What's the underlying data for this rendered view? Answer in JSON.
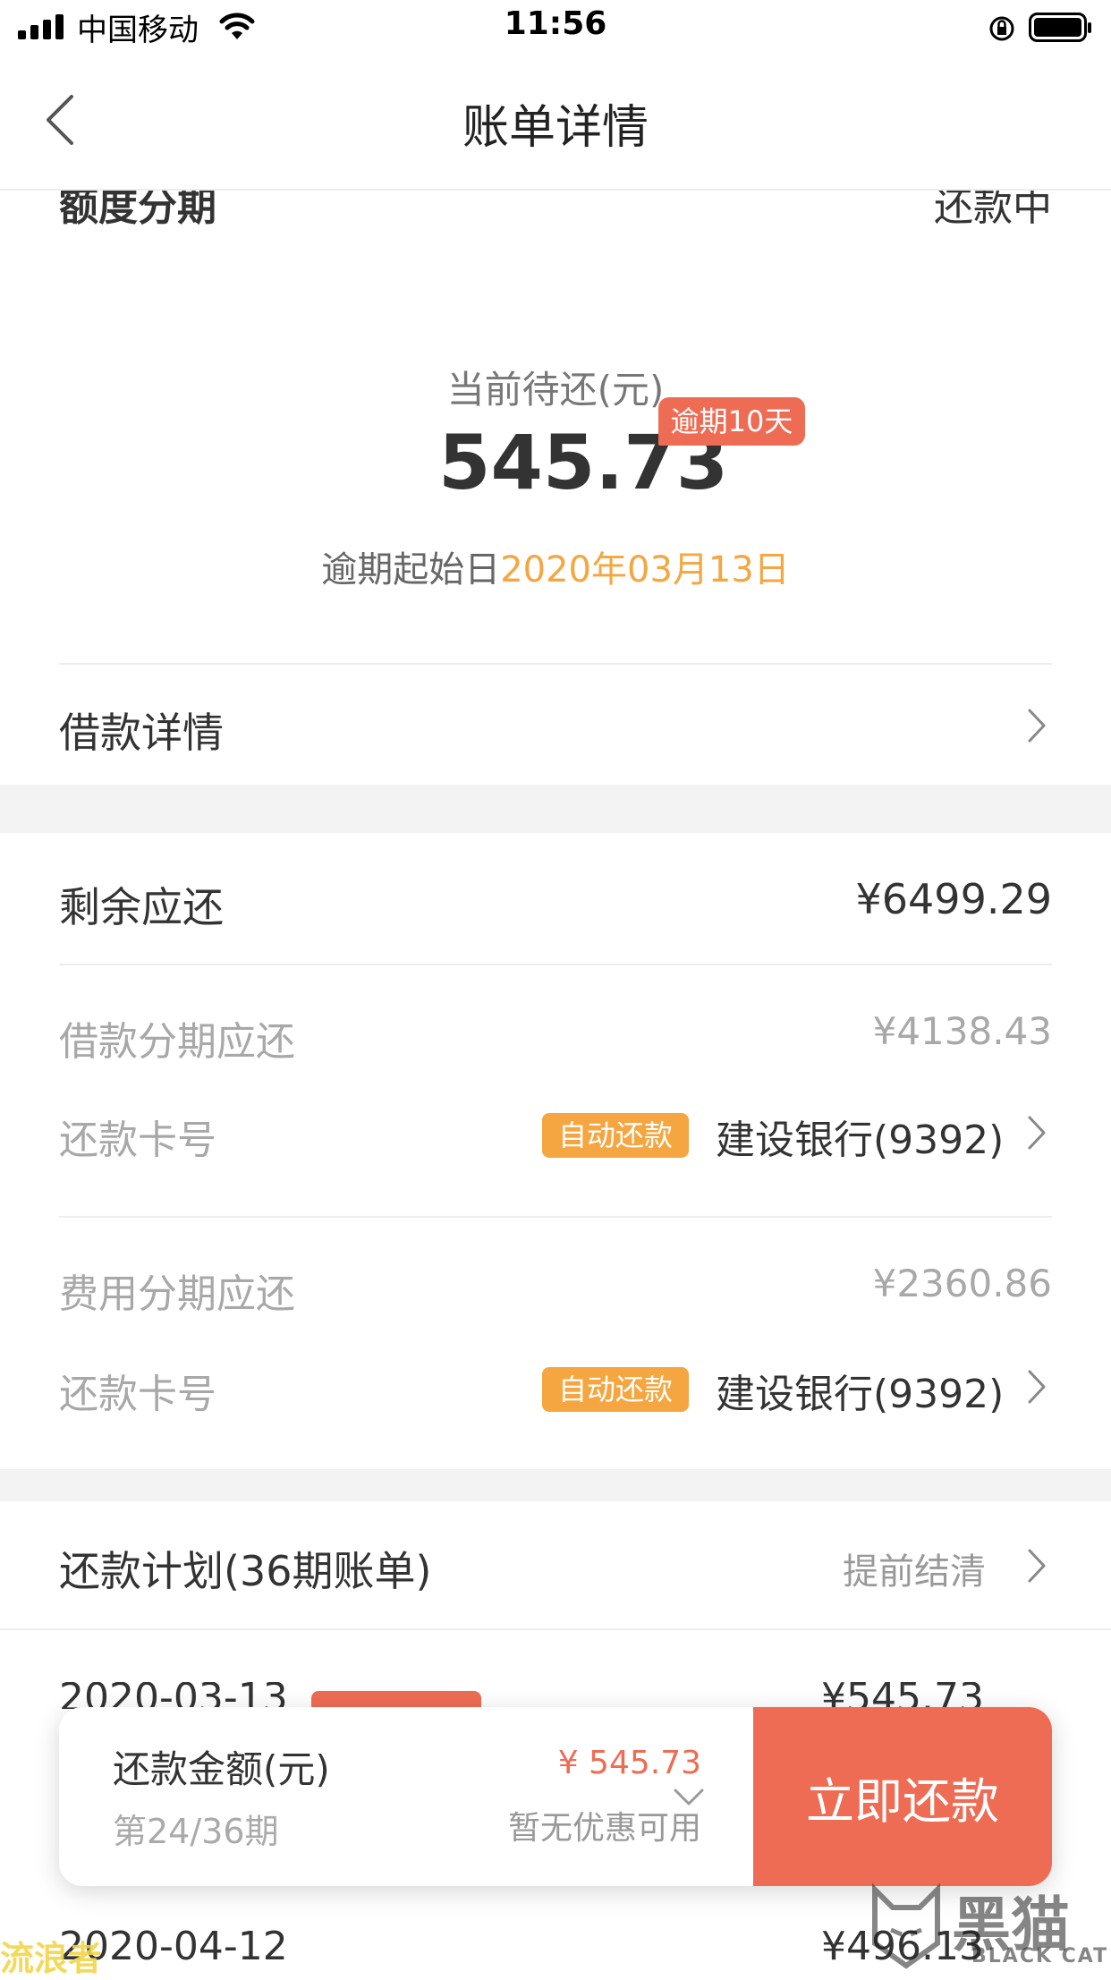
{
  "status_bar": {
    "carrier": "中国移动",
    "time": "11:56"
  },
  "header": {
    "title": "账单详情"
  },
  "summary": {
    "product": "额度分期",
    "status": "还款中",
    "pending_label": "当前待还(元)",
    "pending_amount": "545.73",
    "overdue_badge": "逾期10天",
    "overdue_start_label": "逾期起始日",
    "overdue_start_date": "2020年03月13日"
  },
  "loan_details": {
    "label": "借款详情"
  },
  "remaining": {
    "label": "剩余应还",
    "amount": "¥6499.29",
    "groups": [
      {
        "label": "借款分期应还",
        "amount": "¥4138.43",
        "card_label": "还款卡号",
        "tag": "自动还款",
        "bank": "建设银行(9392)"
      },
      {
        "label": "费用分期应还",
        "amount": "¥2360.86",
        "card_label": "还款卡号",
        "tag": "自动还款",
        "bank": "建设银行(9392)"
      }
    ]
  },
  "plan": {
    "title": "还款计划(36期账单)",
    "action": "提前结清",
    "rows": [
      {
        "date": "2020-03-13",
        "amount": "¥545.73"
      },
      {
        "date": "2020-04-12",
        "amount": "¥496.13"
      }
    ]
  },
  "bottom_bar": {
    "amount_label": "还款金额(元)",
    "period": "第24/36期",
    "amount": "¥ 545.73",
    "discount": "暂无优惠可用",
    "pay_button": "立即还款"
  },
  "watermarks": {
    "left": "流浪者",
    "right": "黑猫",
    "right_sub": "BLACK CAT"
  },
  "colors": {
    "accent_red": "#ee6c54",
    "accent_orange": "#f5a640",
    "date_orange": "#f5a640"
  }
}
